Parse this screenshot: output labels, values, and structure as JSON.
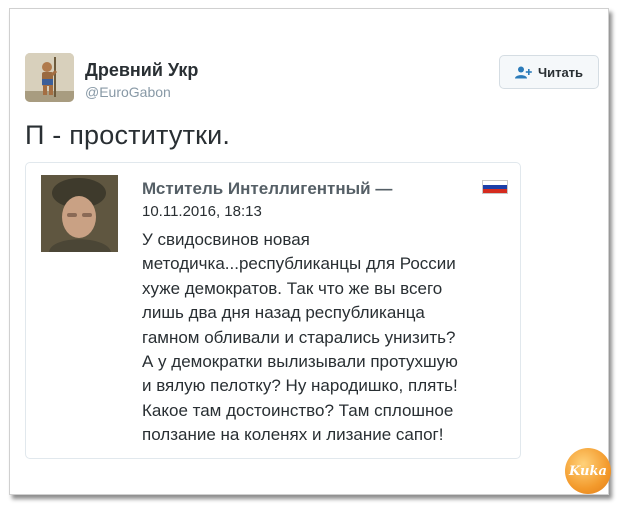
{
  "author": {
    "name": "Древний Укр",
    "handle": "@EuroGabon",
    "avatar_icon": "warrior-statue-avatar"
  },
  "follow_button": {
    "label": "Читать",
    "icon": "add-user-icon",
    "accent": "#2b7bb9"
  },
  "tweet": {
    "text": "П - проститутки."
  },
  "quoted": {
    "name": "Мститель Интеллигентный —",
    "date": "10.11.2016, 18:13",
    "flag_icon": "russia-flag-icon",
    "lines": [
      "У свидосвинов новая",
      "методичка...республиканцы для России",
      "хуже демократов. Так что же вы всего",
      "лишь два дня назад республиканца",
      "гамном обливали и старались унизить?",
      "А у демократки вылизывали протухшую",
      "и вялую пелотку? Ну народишко, плять!",
      "Какое там достоинство? Там сплошное",
      "ползание на коленях и лизание сапог!"
    ]
  },
  "watermark": {
    "text": "Kuka"
  }
}
